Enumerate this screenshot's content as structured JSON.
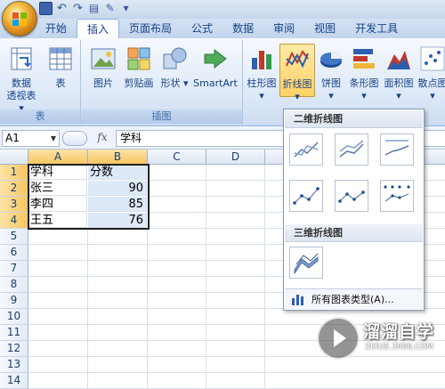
{
  "tabs": [
    "开始",
    "插入",
    "页面布局",
    "公式",
    "数据",
    "审阅",
    "视图",
    "开发工具"
  ],
  "active_tab": "插入",
  "ribbon": {
    "groups": {
      "table": "表",
      "illustrations": "插图"
    },
    "buttons": {
      "pivot_line1": "数据",
      "pivot_line2": "透视表",
      "table": "表",
      "picture": "图片",
      "clipart": "剪贴画",
      "shapes": "形状",
      "smartart": "SmartArt",
      "column": "柱形图",
      "line": "折线图",
      "pie": "饼图",
      "bar": "条形图",
      "area": "面积图",
      "scatter": "散点图"
    }
  },
  "formula_bar": {
    "name_box": "A1",
    "fx": "fx",
    "value": "学科"
  },
  "sheet": {
    "columns": [
      "A",
      "B",
      "C",
      "D"
    ],
    "rows": [
      "1",
      "2",
      "3",
      "4",
      "5",
      "6",
      "7",
      "8",
      "9",
      "10",
      "11",
      "12",
      "13",
      "14"
    ],
    "data": [
      [
        "学科",
        "分数"
      ],
      [
        "张三",
        "90"
      ],
      [
        "李四",
        "85"
      ],
      [
        "王五",
        "76"
      ]
    ]
  },
  "dropdown": {
    "section_2d": "二维折线图",
    "section_3d": "三维折线图",
    "all_types": "所有图表类型(A)..."
  },
  "watermark": {
    "title": "溜溜自学",
    "url": "ZIXUE.3066.COM"
  },
  "colors": {
    "accent": "#15428b",
    "ribbon_bg": "#dbe7f7",
    "selected_button": "#ffd264"
  }
}
